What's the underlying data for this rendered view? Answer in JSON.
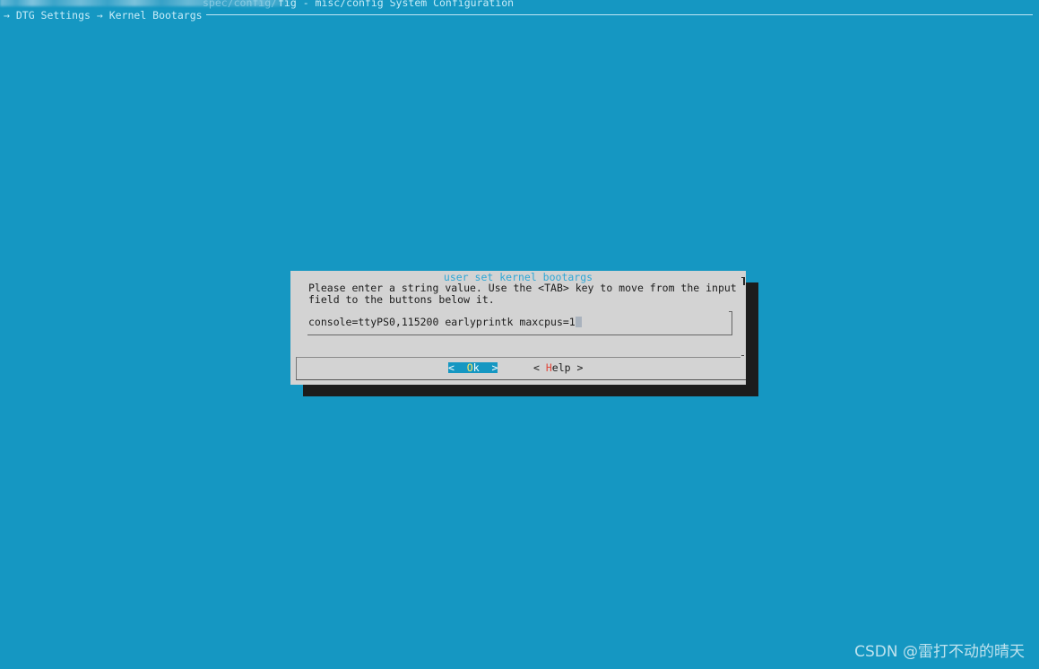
{
  "window": {
    "title_path": "spec/config/",
    "title": "fig - misc/config System Configuration"
  },
  "breadcrumb": "→ DTG Settings → Kernel Bootargs",
  "dialog": {
    "title": "user set kernel bootargs",
    "prompt_line1": "Please enter a string value. Use the <TAB> key to move from the input",
    "prompt_line2": "field to the buttons below it.",
    "input_value": "console=ttyPS0,115200 earlyprintk maxcpus=1",
    "buttons": {
      "ok": {
        "left": "<  ",
        "hotkey": "O",
        "rest": "k",
        "right": "  >"
      },
      "help": {
        "left": "< ",
        "hotkey": "H",
        "rest": "elp",
        "right": " >"
      }
    }
  },
  "watermark": "CSDN @雷打不动的晴天",
  "colors": {
    "background": "#1597c2",
    "dialog": "#d3d3d3",
    "shadow": "#1c1c1c",
    "dialog_title": "#2fa7d6",
    "hotkey_selected": "#ffe866",
    "hotkey": "#e0463a"
  }
}
